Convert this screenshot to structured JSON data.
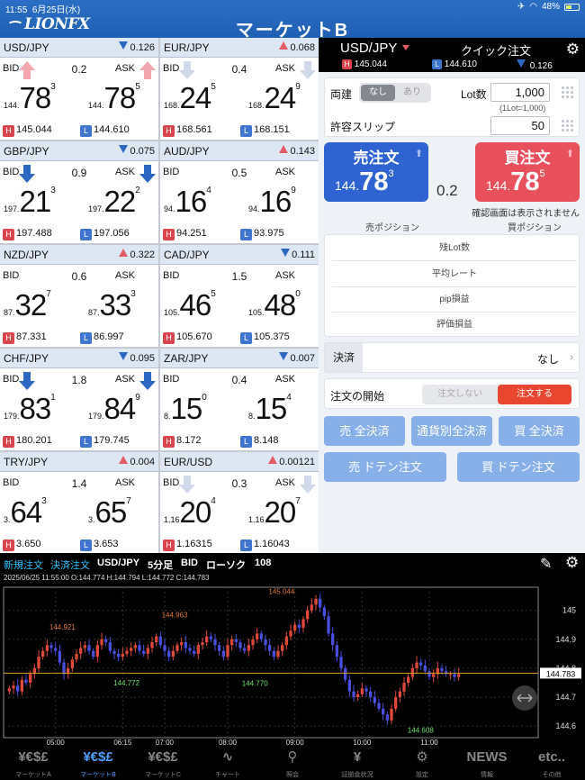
{
  "status": {
    "time": "11:55",
    "date": "6月25日(水)",
    "battery": "48%"
  },
  "header": {
    "logo": "LIONFX",
    "title": "マーケットB"
  },
  "tiles": [
    {
      "pair": "USD/JPY",
      "dir": "down",
      "change": "0.126",
      "bid_dir": "up",
      "ask_dir": "up",
      "spread": "0.2",
      "bid_prefix": "144.",
      "bid_big": "78",
      "bid_small": "3",
      "ask_prefix": "144.",
      "ask_big": "78",
      "ask_small": "5",
      "high": "145.044",
      "low": "144.610"
    },
    {
      "pair": "EUR/JPY",
      "dir": "up",
      "change": "0.068",
      "bid_dir": "down-pale",
      "ask_dir": "down-pale",
      "spread": "0.4",
      "bid_prefix": "168.",
      "bid_big": "24",
      "bid_small": "5",
      "ask_prefix": "168.",
      "ask_big": "24",
      "ask_small": "9",
      "high": "168.561",
      "low": "168.151"
    },
    {
      "pair": "GBP/JPY",
      "dir": "down",
      "change": "0.075",
      "bid_dir": "down",
      "ask_dir": "down",
      "spread": "0.9",
      "bid_prefix": "197.",
      "bid_big": "21",
      "bid_small": "3",
      "ask_prefix": "197.",
      "ask_big": "22",
      "ask_small": "2",
      "high": "197.488",
      "low": "197.056"
    },
    {
      "pair": "AUD/JPY",
      "dir": "up",
      "change": "0.143",
      "bid_dir": "none",
      "ask_dir": "none",
      "spread": "0.5",
      "bid_prefix": "94.",
      "bid_big": "16",
      "bid_small": "4",
      "ask_prefix": "94.",
      "ask_big": "16",
      "ask_small": "9",
      "high": "94.251",
      "low": "93.975"
    },
    {
      "pair": "NZD/JPY",
      "dir": "up",
      "change": "0.322",
      "bid_dir": "none",
      "ask_dir": "none",
      "spread": "0.6",
      "bid_prefix": "87.",
      "bid_big": "32",
      "bid_small": "7",
      "ask_prefix": "87.",
      "ask_big": "33",
      "ask_small": "3",
      "high": "87.331",
      "low": "86.997"
    },
    {
      "pair": "CAD/JPY",
      "dir": "down",
      "change": "0.111",
      "bid_dir": "none",
      "ask_dir": "none",
      "spread": "1.5",
      "bid_prefix": "105.",
      "bid_big": "46",
      "bid_small": "5",
      "ask_prefix": "105.",
      "ask_big": "48",
      "ask_small": "0",
      "high": "105.670",
      "low": "105.375"
    },
    {
      "pair": "CHF/JPY",
      "dir": "down",
      "change": "0.095",
      "bid_dir": "down",
      "ask_dir": "down",
      "spread": "1.8",
      "bid_prefix": "179.",
      "bid_big": "83",
      "bid_small": "1",
      "ask_prefix": "179.",
      "ask_big": "84",
      "ask_small": "9",
      "high": "180.201",
      "low": "179.745"
    },
    {
      "pair": "ZAR/JPY",
      "dir": "down",
      "change": "0.007",
      "bid_dir": "none",
      "ask_dir": "none",
      "spread": "0.4",
      "bid_prefix": "8.",
      "bid_big": "15",
      "bid_small": "0",
      "ask_prefix": "8.",
      "ask_big": "15",
      "ask_small": "4",
      "high": "8.172",
      "low": "8.148"
    },
    {
      "pair": "TRY/JPY",
      "dir": "up",
      "change": "0.004",
      "bid_dir": "none",
      "ask_dir": "none",
      "spread": "1.4",
      "bid_prefix": "3.",
      "bid_big": "64",
      "bid_small": "3",
      "ask_prefix": "3.",
      "ask_big": "65",
      "ask_small": "7",
      "high": "3.650",
      "low": "3.653"
    },
    {
      "pair": "EUR/USD",
      "dir": "up",
      "change": "0.00121",
      "bid_dir": "down-pale",
      "ask_dir": "down-pale",
      "spread": "0.3",
      "bid_prefix": "1.16",
      "bid_big": "20",
      "bid_small": "4",
      "ask_prefix": "1.16",
      "ask_big": "20",
      "ask_small": "7",
      "high": "1.16315",
      "low": "1.16043"
    }
  ],
  "tile_labels": {
    "bid": "BID",
    "ask": "ASK",
    "high_key": "H",
    "low_key": "L"
  },
  "quick": {
    "pair": "USD/JPY",
    "title": "クイック注文",
    "high_key": "H",
    "high": "145.044",
    "low_key": "L",
    "low": "144.610",
    "change": "0.126",
    "ryodate_label": "両建",
    "ryodate_opts": [
      "なし",
      "あり"
    ],
    "lot_label": "Lot数",
    "lot_value": "1,000",
    "lot_note": "(1Lot=1,000)",
    "slip_label": "許容スリップ",
    "slip_value": "50",
    "sell_label": "売注文",
    "sell_prefix": "144.",
    "sell_big": "78",
    "sell_small": "3",
    "buy_label": "買注文",
    "buy_prefix": "144.",
    "buy_big": "78",
    "buy_small": "5",
    "spread": "0.2",
    "confirm_note": "確認画面は表示されません",
    "sell_pos": "売ポジション",
    "buy_pos": "買ポジション",
    "pos_rows": [
      "残Lot数",
      "平均レート",
      "pip損益",
      "評価損益"
    ],
    "kessai_label": "決済",
    "kessai_value": "なし",
    "start_label": "注文の開始",
    "start_opts": [
      "注文しない",
      "注文する"
    ],
    "btn_sell_all": "売 全決済",
    "btn_pair_all": "通貨別全決済",
    "btn_buy_all": "買 全決済",
    "btn_sell_doten": "売 ドテン注文",
    "btn_buy_doten": "買 ドテン注文"
  },
  "chart_toolbar": {
    "new_order": "新規注文",
    "close_order": "決済注文",
    "pair": "USD/JPY",
    "timeframe": "5分足",
    "side": "BID",
    "style": "ローソク",
    "count": "108"
  },
  "chart_info": "2025/06/25 11:55:00  O:144.774  H:144.794  L:144.772  C:144.783",
  "chart_data": {
    "type": "candlestick",
    "x_ticks": [
      "05:00",
      "06:15",
      "07:00",
      "08:00",
      "09:00",
      "10:00",
      "11:00"
    ],
    "y_ticks": [
      145.0,
      144.9,
      144.8,
      144.7,
      144.6
    ],
    "ylim": [
      144.56,
      145.08
    ],
    "current_price": 144.783,
    "annotations": [
      {
        "label": "145.044",
        "value": 145.044
      },
      {
        "label": "144.963",
        "value": 144.963
      },
      {
        "label": "144.921",
        "value": 144.921
      },
      {
        "label": "144.772",
        "value": 144.772
      },
      {
        "label": "144.770",
        "value": 144.77
      },
      {
        "label": "144.608",
        "value": 144.608
      }
    ],
    "close": [
      144.73,
      144.74,
      144.72,
      144.76,
      144.75,
      144.78,
      144.8,
      144.84,
      144.86,
      144.88,
      144.87,
      144.86,
      144.82,
      144.78,
      144.8,
      144.83,
      144.85,
      144.87,
      144.88,
      144.86,
      144.84,
      144.88,
      144.9,
      144.89,
      144.86,
      144.85,
      144.84,
      144.85,
      144.86,
      144.87,
      144.88,
      144.86,
      144.85,
      144.87,
      144.89,
      144.91,
      144.88,
      144.86,
      144.84,
      144.86,
      144.88,
      144.89,
      144.87,
      144.86,
      144.85,
      144.88,
      144.89,
      144.91,
      144.9,
      144.88,
      144.86,
      144.84,
      144.88,
      144.9,
      144.89,
      144.87,
      144.86,
      144.88,
      144.9,
      144.92,
      144.9,
      144.88,
      144.86,
      144.84,
      144.86,
      144.88,
      144.91,
      144.93,
      144.95,
      144.94,
      144.97,
      145.0,
      145.02,
      145.04,
      145.01,
      144.98,
      144.92,
      144.88,
      144.84,
      144.8,
      144.76,
      144.72,
      144.7,
      144.71,
      144.73,
      144.72,
      144.7,
      144.68,
      144.66,
      144.64,
      144.62,
      144.66,
      144.7,
      144.72,
      144.75,
      144.77,
      144.8,
      144.82,
      144.81,
      144.79,
      144.77,
      144.78,
      144.8,
      144.79,
      144.78,
      144.78,
      144.77,
      144.78
    ]
  },
  "tabs": [
    {
      "icon": "¥€$£",
      "label": "マーケットA"
    },
    {
      "icon": "¥€$£",
      "label": "マーケットB"
    },
    {
      "icon": "¥€$£",
      "label": "マーケットC"
    },
    {
      "icon": "∿",
      "label": "チャート"
    },
    {
      "icon": "⚲",
      "label": "照会"
    },
    {
      "icon": "¥",
      "label": "証拠金状況"
    },
    {
      "icon": "⚙",
      "label": "設定"
    },
    {
      "icon": "NEWS",
      "label": "情報"
    },
    {
      "icon": "etc..",
      "label": "その他"
    }
  ],
  "active_tab": 1,
  "colors": {
    "accent": "#2b6fc5",
    "sell": "#2f63d2",
    "buy": "#e8505c",
    "up": "#e35b66",
    "down": "#2b67c3"
  }
}
